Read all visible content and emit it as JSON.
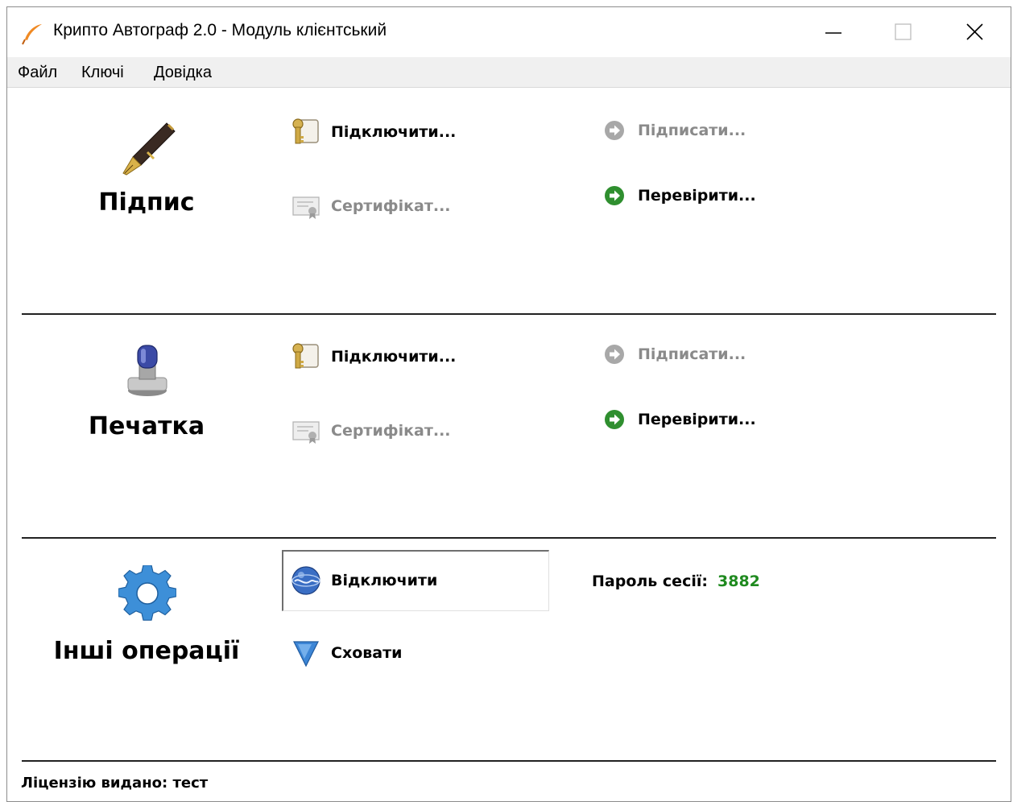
{
  "window": {
    "title": "Крипто Автограф 2.0 - Модуль клієнтський"
  },
  "menu": {
    "file": "Файл",
    "keys": "Ключі",
    "help": "Довідка"
  },
  "sections": {
    "signature": {
      "title": "Підпис",
      "connect": "Підключити...",
      "certificate": "Сертифікат...",
      "sign": "Підписати...",
      "verify": "Перевірити..."
    },
    "stamp": {
      "title": "Печатка",
      "connect": "Підключити...",
      "certificate": "Сертифікат...",
      "sign": "Підписати...",
      "verify": "Перевірити..."
    },
    "other": {
      "title": "Інші операції",
      "disconnect": "Відключити",
      "hide": "Сховати",
      "session_password_label": "Пароль сесії:",
      "session_password_value": "3882"
    }
  },
  "footer": {
    "license": "Ліцензію видано: тест"
  },
  "colors": {
    "accent_green": "#1f8a1f",
    "disabled_text": "#8a8a8a",
    "menubar_bg": "#f0f0f0"
  },
  "icons": {
    "app": "feather-pen-icon",
    "signature": "fountain-pen-icon",
    "stamp": "rubber-stamp-icon",
    "other": "gear-icon",
    "connect": "key-document-icon",
    "certificate": "certificate-icon",
    "sign": "arrow-circle-icon",
    "verify": "arrow-circle-icon",
    "disconnect": "globe-icon",
    "hide": "triangle-down-icon"
  }
}
